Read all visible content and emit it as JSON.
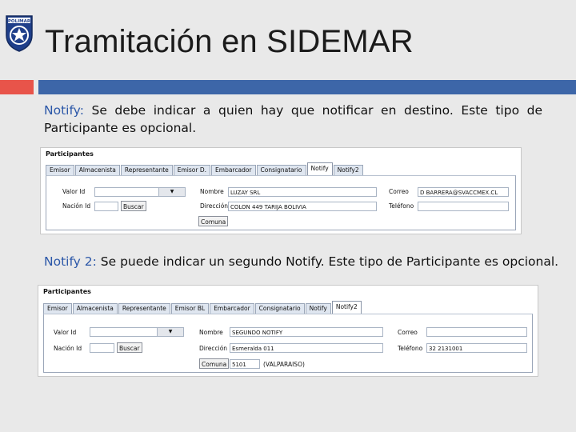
{
  "header": {
    "title": "Tramitación en SIDEMAR"
  },
  "logo": {
    "icon": "star-shield-logo",
    "text": "POLIMAR",
    "color": "#1f3f8a"
  },
  "colors": {
    "accent_red": "#e8544a",
    "accent_blue": "#3d66a8"
  },
  "para1": {
    "keyword": "Notify:",
    "text": " Se debe indicar a quien hay que notificar en destino. Este tipo de Participante es opcional."
  },
  "para2": {
    "keyword": "Notify 2:",
    "text": " Se puede indicar un segundo Notify.  Este tipo de Participante es opcional."
  },
  "shot1": {
    "heading": "Participantes",
    "tabs": [
      "Emisor",
      "Almacenista",
      "Representante",
      "Emisor D.",
      "Embarcador",
      "Consignatario",
      "Notify",
      "Notify2"
    ],
    "active_tab": "Notify",
    "labels": {
      "valor_id": "Valor Id",
      "nacion_id": "Nación Id",
      "nombre": "Nombre",
      "direccion": "Dirección",
      "correo": "Correo",
      "telefono": "Teléfono"
    },
    "values": {
      "valor_id": "",
      "nacion_id": "",
      "nombre": "LUZAY SRL",
      "direccion": "COLON 449 TARIJA BOLIVIA",
      "correo": "D BARRERA@SVACCMEX.CL",
      "telefono": ""
    },
    "buttons": {
      "buscar": "Buscar",
      "comuna": "Comuna"
    }
  },
  "shot2": {
    "heading": "Participantes",
    "tabs": [
      "Emisor",
      "Almacenista",
      "Representante",
      "Emisor BL",
      "Embarcador",
      "Consignatario",
      "Notify",
      "Notify2"
    ],
    "active_tab": "Notify2",
    "labels": {
      "valor_id": "Valor Id",
      "nacion_id": "Nación Id",
      "nombre": "Nombre",
      "direccion": "Dirección",
      "correo": "Correo",
      "telefono": "Teléfono"
    },
    "values": {
      "valor_id": "",
      "nacion_id": "",
      "nombre": "SEGUNDO NOTIFY",
      "direccion": "Esmeralda 011",
      "correo": "",
      "telefono": "32 2131001",
      "comuna_code": "5101",
      "comuna_name": "(VALPARAISO)"
    },
    "buttons": {
      "buscar": "Buscar",
      "comuna": "Comuna"
    }
  }
}
